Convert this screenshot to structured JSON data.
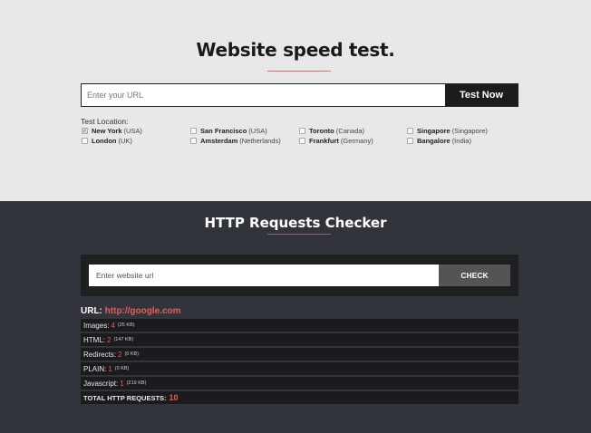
{
  "speed_test": {
    "title": "Website speed test.",
    "url_placeholder": "Enter your URL",
    "button_label": "Test Now",
    "location_title": "Test Location:",
    "locations": [
      {
        "city": "New York",
        "country": "(USA)",
        "checked": true
      },
      {
        "city": "San Francisco",
        "country": "(USA)",
        "checked": false
      },
      {
        "city": "Toronto",
        "country": "(Canada)",
        "checked": false
      },
      {
        "city": "Singapore",
        "country": "(Singapore)",
        "checked": false
      },
      {
        "city": "London",
        "country": "(UK)",
        "checked": false
      },
      {
        "city": "Amsterdam",
        "country": "(Netherlands)",
        "checked": false
      },
      {
        "city": "Frankfurt",
        "country": "(Germany)",
        "checked": false
      },
      {
        "city": "Bangalore",
        "country": "(India)",
        "checked": false
      }
    ]
  },
  "http_checker": {
    "title": "HTTP Requests Checker",
    "input_placeholder": "Enter website url",
    "button_label": "CHECK",
    "url_label": "URL:",
    "url_value": "http://google.com",
    "rows": [
      {
        "label": "Images:",
        "count": "4",
        "size": "(25 KB)"
      },
      {
        "label": "HTML:",
        "count": "2",
        "size": "(147 KB)"
      },
      {
        "label": "Redirects:",
        "count": "2",
        "size": "(0 KB)"
      },
      {
        "label": "PLAIN:",
        "count": "1",
        "size": "(0 KB)"
      },
      {
        "label": "Javascript:",
        "count": "1",
        "size": "(219 KB)"
      }
    ],
    "total_label": "TOTAL HTTP REQUESTS:",
    "total_value": "10"
  },
  "colors": {
    "accent": "#e35d5d",
    "top_bg": "#e8e8e9",
    "bottom_bg": "#31353b"
  }
}
